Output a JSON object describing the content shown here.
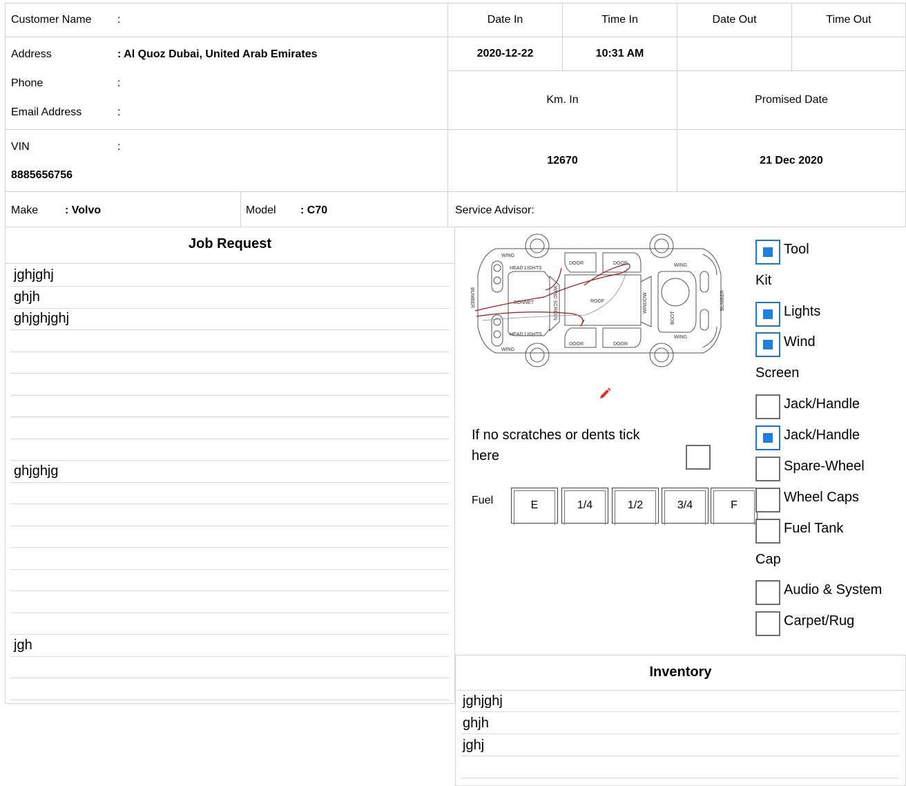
{
  "customer": {
    "name_label": "Customer Name",
    "name_sep": ":",
    "address_label": "Address",
    "address_value": ": Al Quoz Dubai, United Arab Emirates",
    "phone_label": "Phone",
    "phone_sep": ":",
    "email_label": "Email Address",
    "email_sep": ":",
    "vin_label": "VIN",
    "vin_sep": ":",
    "vin_value": "8885656756"
  },
  "dates": {
    "date_in_label": "Date In",
    "time_in_label": "Time In",
    "date_out_label": "Date Out",
    "time_out_label": "Time Out",
    "date_in": "2020-12-22",
    "time_in": "10:31 AM",
    "date_out": "",
    "time_out": "",
    "km_in_label": "Km. In",
    "promised_label": "Promised Date",
    "km_in": "12670",
    "promised_date": "21 Dec 2020"
  },
  "vehicle": {
    "make_label": "Make",
    "make_value": ": Volvo",
    "model_label": "Model",
    "model_value": ": C70",
    "advisor_label": "Service Advisor:"
  },
  "job_request": {
    "title": "Job Request",
    "lines": [
      "jghjghj",
      "ghjh",
      "ghjghjghj",
      "",
      "",
      "",
      "",
      "",
      "",
      "ghjghjg",
      "",
      "",
      "",
      "",
      "",
      "",
      "",
      "jgh",
      "",
      ""
    ]
  },
  "diagram": {
    "labels": {
      "wing": "WING",
      "head_lights": "HEAD LIGHTS",
      "door": "DOOR",
      "bonnet": "BONNET",
      "wind_screen": "WIND SCREEN",
      "roof": "ROOF",
      "window": "WINDOW",
      "boot": "BOOT",
      "bumber": "BUMBER"
    },
    "pencil_icon": "pencil-icon",
    "scratch_label": "If no scratches or dents tick here",
    "scratch_checked": false
  },
  "fuel": {
    "label": "Fuel",
    "levels": [
      "E",
      "1/4",
      "1/2",
      "3/4",
      "F"
    ]
  },
  "checklist": {
    "tool_kit": {
      "label": "Tool",
      "label_cont": "Kit",
      "checked": true
    },
    "lights": {
      "label": "Lights",
      "checked": true
    },
    "wind_screen": {
      "label": "Wind",
      "label_cont": "Screen",
      "checked": true
    },
    "jack_handle_1": {
      "label": "Jack/Handle",
      "checked": false
    },
    "jack_handle_2": {
      "label": "Jack/Handle",
      "checked": true
    },
    "spare_wheel": {
      "label": "Spare-Wheel",
      "checked": false
    },
    "wheel_caps": {
      "label": "Wheel Caps",
      "checked": false
    },
    "fuel_tank_cap": {
      "label": "Fuel Tank",
      "label_cont": "Cap",
      "checked": false
    },
    "audio_system": {
      "label": "Audio & System",
      "checked": false
    },
    "carpet_rug": {
      "label": "Carpet/Rug",
      "checked": false
    }
  },
  "inventory": {
    "title": "Inventory",
    "lines": [
      "jghjghj",
      "ghjh",
      "jghj",
      ""
    ]
  },
  "colors": {
    "border": "#cfcfcf",
    "check_accent": "#1e7fe0",
    "sketch_red": "#a01818",
    "pencil_red": "#e0302a"
  }
}
